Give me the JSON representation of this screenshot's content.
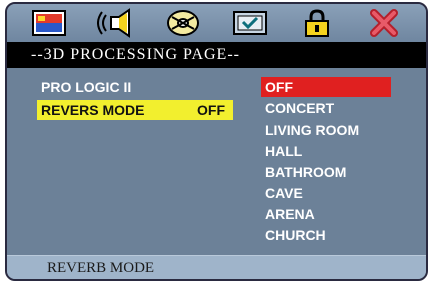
{
  "icons": [
    {
      "name": "language-flag-icon"
    },
    {
      "name": "audio-speaker-icon"
    },
    {
      "name": "video-disc-icon"
    },
    {
      "name": "preference-checkmark-icon"
    },
    {
      "name": "password-lock-icon"
    },
    {
      "name": "exit-x-icon"
    }
  ],
  "title": "--3D PROCESSING PAGE--",
  "menu": {
    "pro_logic_label": "PRO LOGIC II",
    "reverb_label": "REVERS MODE",
    "reverb_value": "OFF"
  },
  "options": [
    "OFF",
    "CONCERT",
    "LIVING ROOM",
    "HALL",
    "BATHROOM",
    "CAVE",
    "ARENA",
    "CHURCH"
  ],
  "status_text": "REVERB MODE",
  "colors": {
    "highlight_yellow": "#f2ef2e",
    "selected_red": "#e02020",
    "panel_blue": "#6c8198"
  }
}
